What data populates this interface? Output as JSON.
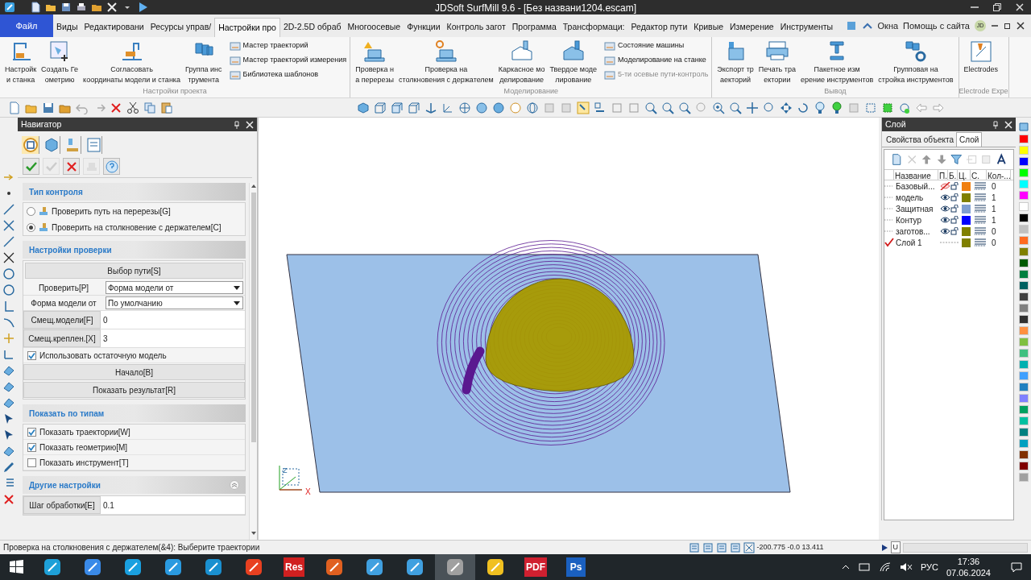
{
  "window": {
    "title": "JDSoft SurfMill 9.6 - [Без названи1204.escam]"
  },
  "file_menu": "Файл",
  "menu_tabs": [
    {
      "label": "Виды",
      "selected": false
    },
    {
      "label": "Редактировани",
      "selected": false
    },
    {
      "label": "Ресурсы управ/",
      "selected": false
    },
    {
      "label": "Настройки про",
      "selected": true
    },
    {
      "label": "2D-2.5D обраб",
      "selected": false
    },
    {
      "label": "Многоосевые",
      "selected": false
    },
    {
      "label": "Функции",
      "selected": false
    },
    {
      "label": "Контроль загот",
      "selected": false
    },
    {
      "label": "Программа",
      "selected": false
    },
    {
      "label": "Трансформаци:",
      "selected": false
    },
    {
      "label": "Редактор пути",
      "selected": false
    },
    {
      "label": "Кривые",
      "selected": false
    },
    {
      "label": "Измерение",
      "selected": false
    },
    {
      "label": "Инструменты",
      "selected": false
    }
  ],
  "menu_right": {
    "windows": "Окна",
    "help": "Помощь с сайта",
    "user": "JD"
  },
  "ribbon_groups": [
    {
      "label": "Настройки проекта",
      "large_buttons": [
        "Настройк\nи станка",
        "Создать Ге\nометрию",
        "Согласовать\nкоординаты модели и станка",
        "Группа инс\nтрумента"
      ],
      "small_buttons": [
        {
          "label": "Мастер траекторий",
          "disabled": false
        },
        {
          "label": "Мастер траекторий измерения",
          "disabled": false
        },
        {
          "label": "Библиотека шаблонов",
          "disabled": false
        }
      ]
    },
    {
      "label": "Моделирование",
      "large_buttons": [
        "Проверка н\nа перерезы",
        "Проверка на\nстолкновения с держателем",
        "Каркасное мо\nделирование",
        "Твердое моде\nлирование"
      ],
      "small_buttons": [
        {
          "label": "Состояние машины",
          "disabled": false
        },
        {
          "label": "Моделирование на станке",
          "disabled": false
        },
        {
          "label": "5-ти осевые пути-контроль",
          "disabled": true
        }
      ]
    },
    {
      "label": "Вывод",
      "large_buttons": [
        "Экспорт тр\nаекторий",
        "Печать тра\nектории",
        "Пакетное изм\nерение инструментов",
        "Групповая на\nстройка инструментов"
      ]
    },
    {
      "label": "Electrode Expe",
      "large_buttons": [
        "Electrodes"
      ]
    }
  ],
  "navigator": {
    "title": "Навигатор",
    "icon_tabs": [
      {
        "selected": true
      },
      {
        "selected": false
      },
      {
        "selected": false
      },
      {
        "selected": false
      }
    ],
    "actions": [
      {
        "kind": "ok",
        "disabled": false
      },
      {
        "kind": "ok",
        "disabled": true
      },
      {
        "kind": "cancel",
        "disabled": false
      },
      {
        "kind": "apply",
        "disabled": true
      },
      {
        "kind": "help",
        "disabled": false
      }
    ],
    "sections": [
      {
        "title": "Тип контроля",
        "collapsible": false,
        "items": [
          {
            "kind": "radio",
            "label": "Проверить путь на перерезы[G]",
            "selected": false
          },
          {
            "kind": "radio",
            "label": "Проверить на столкновение с держателем[C]",
            "selected": true
          }
        ]
      },
      {
        "title": "Настройки проверки",
        "collapsible": false,
        "items": [
          {
            "kind": "button",
            "label": "Выбор пути[S]"
          },
          {
            "kind": "dropdown",
            "label": "Проверить[P]",
            "value": "Форма модели от"
          },
          {
            "kind": "dropdown",
            "label": "Форма модели от",
            "value": "По умолчанию"
          },
          {
            "kind": "field",
            "label": "Смещ.модели[F]",
            "value": "0"
          },
          {
            "kind": "field",
            "label": "Смещ.креплен.[X]",
            "value": "3"
          },
          {
            "kind": "checkbox",
            "label": "Использовать остаточную модель",
            "checked": true
          },
          {
            "kind": "wide_button",
            "label": "Начало[B]"
          },
          {
            "kind": "wide_button",
            "label": "Показать результат[R]"
          }
        ]
      },
      {
        "title": "Показать по типам",
        "collapsible": false,
        "items": [
          {
            "kind": "checkbox",
            "label": "Показать траектории[W]",
            "checked": true
          },
          {
            "kind": "checkbox",
            "label": "Показать геометрию[M]",
            "checked": true
          },
          {
            "kind": "checkbox",
            "label": "Показать инструмент[T]",
            "checked": false
          }
        ]
      },
      {
        "title": "Другие настройки",
        "collapsible": true,
        "items": [
          {
            "kind": "field",
            "label": "Шаг обработки[E]",
            "value": "0.1"
          }
        ]
      }
    ]
  },
  "viewport": {
    "axis_labels": [
      "Z",
      "X"
    ]
  },
  "layer_panel": {
    "title": "Слой",
    "tabs": [
      {
        "label": "Свойства объекта",
        "selected": false
      },
      {
        "label": "Слой",
        "selected": true
      }
    ],
    "columns": [
      "Название",
      "П.",
      "Б.",
      "Ц.",
      "С.",
      "Кол-..."
    ],
    "rows": [
      {
        "name": "Базовый...",
        "current": false,
        "visible": false,
        "color": "#f07f10",
        "count": "0"
      },
      {
        "name": "модель",
        "current": false,
        "visible": true,
        "color": "#808000",
        "count": "1"
      },
      {
        "name": "Защитная",
        "current": false,
        "visible": true,
        "color": "#7f9fd0",
        "count": "1"
      },
      {
        "name": "Контур",
        "current": false,
        "visible": true,
        "color": "#0000ff",
        "count": "1"
      },
      {
        "name": "заготов...",
        "current": false,
        "visible": true,
        "color": "#808000",
        "count": "0"
      },
      {
        "name": "Слой 1",
        "current": true,
        "color": "#808000",
        "count": "0"
      }
    ]
  },
  "palette": [
    {
      "color": "#ff0000"
    },
    {
      "color": "#ffff00"
    },
    {
      "color": "#0000ff"
    },
    {
      "color": "#00ff00"
    },
    {
      "color": "#00ffff"
    },
    {
      "color": "#ff00ff"
    },
    {
      "color": "#ffffff"
    },
    {
      "color": "#000000"
    },
    {
      "color": "#c0c0c0"
    },
    {
      "color": "#ff6a20"
    },
    {
      "color": "#808000"
    },
    {
      "color": "#005a00"
    },
    {
      "color": "#008040"
    },
    {
      "color": "#006060"
    },
    {
      "color": "#404040"
    },
    {
      "color": "#808080"
    },
    {
      "color": "#303030"
    },
    {
      "color": "#ff9040"
    },
    {
      "color": "#80c040"
    },
    {
      "color": "#40c080"
    },
    {
      "color": "#00b0b0"
    },
    {
      "color": "#40a0ff"
    },
    {
      "color": "#2080c0"
    },
    {
      "color": "#8080ff"
    },
    {
      "color": "#00a060"
    },
    {
      "color": "#00c0a0"
    },
    {
      "color": "#008080"
    },
    {
      "color": "#00a0c0"
    },
    {
      "color": "#803000"
    },
    {
      "color": "#800000"
    },
    {
      "color": "#a0a0a0"
    }
  ],
  "status_bar": {
    "message": "Проверка на столкновения с держателем(&4): Выберите траектории",
    "coordinates": "-200.775 -0.0 13.411",
    "mode": "U"
  },
  "taskbar": {
    "apps": [
      {
        "kind": "icon",
        "active": false
      },
      {
        "kind": "icon",
        "active": false
      },
      {
        "kind": "icon",
        "active": false
      },
      {
        "kind": "icon",
        "active": false
      },
      {
        "kind": "icon",
        "active": false
      },
      {
        "kind": "icon",
        "active": false
      },
      {
        "kind": "text",
        "label": "Res",
        "active": false
      },
      {
        "kind": "icon",
        "active": false
      },
      {
        "kind": "icon",
        "active": false
      },
      {
        "kind": "icon",
        "active": false
      },
      {
        "kind": "icon",
        "active": true
      },
      {
        "kind": "icon",
        "active": false
      },
      {
        "kind": "text",
        "label": "PDF",
        "active": false
      },
      {
        "kind": "text",
        "label": "Ps",
        "active": false
      }
    ],
    "language": "РУС",
    "time": "17:36",
    "date": "07.06.2024"
  }
}
